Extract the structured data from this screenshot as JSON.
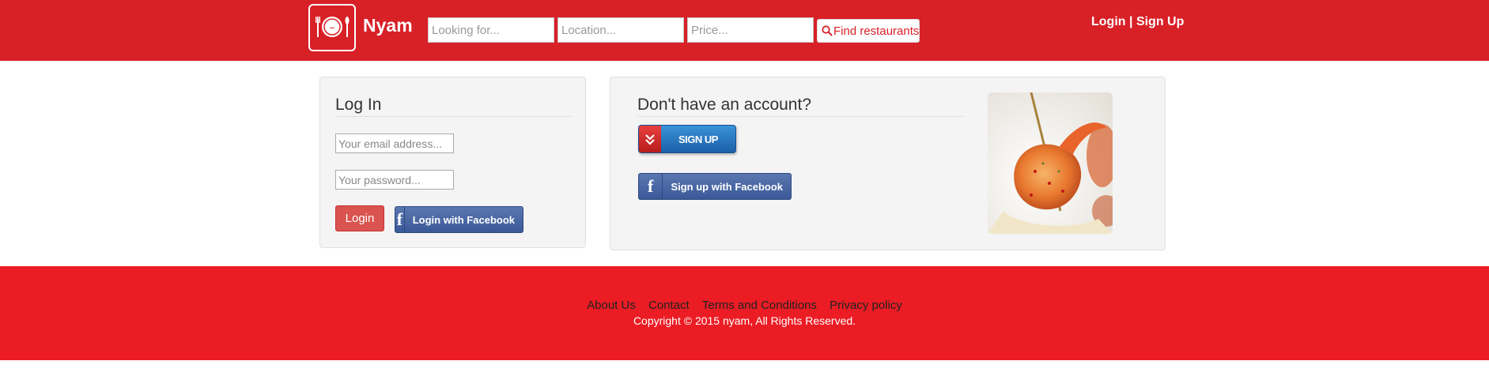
{
  "header": {
    "brand": "Nyam",
    "search": {
      "looking_placeholder": "Looking for...",
      "location_placeholder": "Location...",
      "price_placeholder": "Price...",
      "find_label": "Find restaurants"
    },
    "login_label": "Login",
    "separator": "|",
    "signup_label": "Sign Up",
    "bar_color": "#d82027"
  },
  "login_panel": {
    "title": "Log In",
    "email_placeholder": "Your email address...",
    "password_placeholder": "Your password...",
    "login_button": "Login",
    "facebook_button": "Login with Facebook"
  },
  "signup_panel": {
    "title": "Don't have an account?",
    "signup_button": "SIGN UP",
    "facebook_button": "Sign up with Facebook"
  },
  "footer": {
    "links": [
      "About Us",
      "Contact",
      "Terms and Conditions",
      "Privacy policy"
    ],
    "copyright": "Copyright © 2015 nyam, All Rights Reserved.",
    "bar_color": "#ec1c24"
  }
}
